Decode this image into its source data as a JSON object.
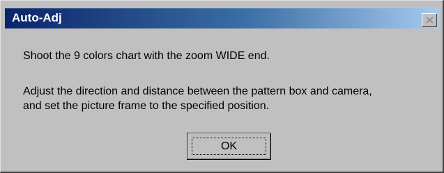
{
  "window": {
    "title": "Auto-Adj",
    "close_icon": "close-icon"
  },
  "message": {
    "line1": "Shoot the 9 colors chart with the zoom WIDE end.",
    "line2": "Adjust the direction and distance between the pattern box and camera,",
    "line3": "and set the picture frame to the specified position."
  },
  "buttons": {
    "ok_label": "OK"
  },
  "colors": {
    "titlebar_start": "#0a246a",
    "titlebar_end": "#a6caf0",
    "dialog_face": "#c0c0c0"
  }
}
